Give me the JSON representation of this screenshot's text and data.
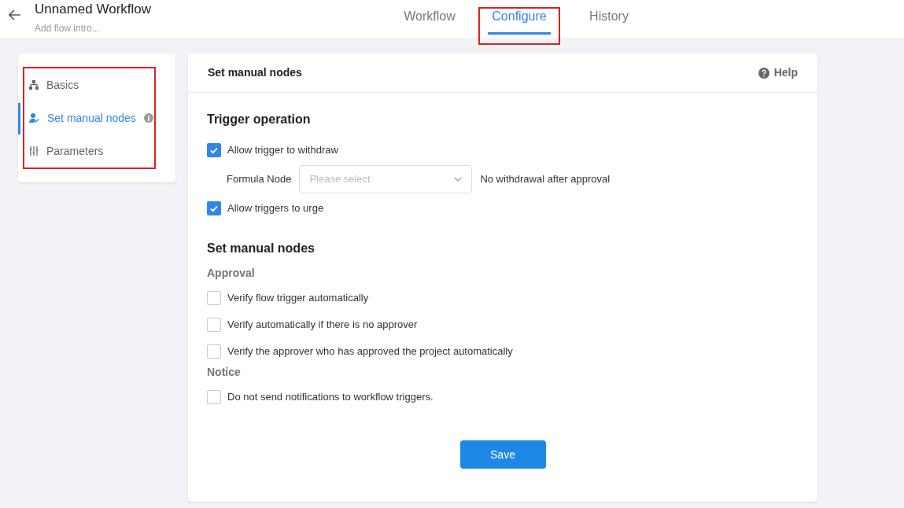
{
  "header": {
    "title": "Unnamed Workflow",
    "subtitle": "Add flow intro..."
  },
  "tabs": [
    {
      "label": "Workflow",
      "selected": false,
      "highlighted": false
    },
    {
      "label": "Configure",
      "selected": true,
      "highlighted": true
    },
    {
      "label": "History",
      "selected": false,
      "highlighted": false
    }
  ],
  "sidebar": {
    "highlighted": true,
    "items": [
      {
        "label": "Basics",
        "selected": false,
        "info": false
      },
      {
        "label": "Set manual nodes",
        "selected": true,
        "info": true
      },
      {
        "label": "Parameters",
        "selected": false,
        "info": false
      }
    ]
  },
  "panel": {
    "title": "Set manual nodes",
    "help": "Help",
    "sections": [
      {
        "title": "Trigger operation",
        "items": [
          {
            "kind": "checkbox",
            "label": "Allow trigger to withdraw",
            "checked": true
          },
          {
            "kind": "select",
            "label": "Formula Node",
            "placeholder": "Please select",
            "note": "No withdrawal after approval"
          },
          {
            "kind": "checkbox",
            "label": "Allow triggers to urge",
            "checked": true
          }
        ]
      },
      {
        "title": "Set manual nodes",
        "items": [
          {
            "kind": "subheading",
            "label": "Approval"
          },
          {
            "kind": "checkbox",
            "label": "Verify flow trigger automatically",
            "checked": false
          },
          {
            "kind": "checkbox",
            "label": "Verify automatically if there is no approver",
            "checked": false
          },
          {
            "kind": "checkbox",
            "label": "Verify the approver who has approved the project automatically",
            "checked": false
          },
          {
            "kind": "subheading",
            "label": "Notice"
          },
          {
            "kind": "checkbox",
            "label": "Do not send notifications to workflow triggers.",
            "checked": false
          }
        ]
      }
    ],
    "save": "Save"
  }
}
